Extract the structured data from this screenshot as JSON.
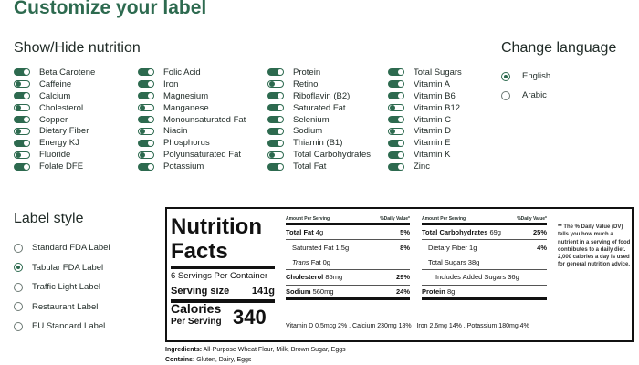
{
  "page_title": "Customize your label",
  "show_hide": {
    "title": "Show/Hide nutrition",
    "columns": [
      [
        {
          "label": "Beta Carotene",
          "on": true
        },
        {
          "label": "Caffeine",
          "on": false
        },
        {
          "label": "Calcium",
          "on": true
        },
        {
          "label": "Cholesterol",
          "on": false
        },
        {
          "label": "Copper",
          "on": true
        },
        {
          "label": "Dietary Fiber",
          "on": false
        },
        {
          "label": "Energy KJ",
          "on": true
        },
        {
          "label": "Fluoride",
          "on": false
        },
        {
          "label": "Folate DFE",
          "on": true
        }
      ],
      [
        {
          "label": "Folic Acid",
          "on": true
        },
        {
          "label": "Iron",
          "on": true
        },
        {
          "label": "Magnesium",
          "on": true
        },
        {
          "label": "Manganese",
          "on": false
        },
        {
          "label": "Monounsaturated Fat",
          "on": true
        },
        {
          "label": "Niacin",
          "on": false
        },
        {
          "label": "Phosphorus",
          "on": true
        },
        {
          "label": "Polyunsaturated Fat",
          "on": false
        },
        {
          "label": "Potassium",
          "on": true
        }
      ],
      [
        {
          "label": "Protein",
          "on": true
        },
        {
          "label": "Retinol",
          "on": false
        },
        {
          "label": "Riboflavin (B2)",
          "on": true
        },
        {
          "label": "Saturated Fat",
          "on": true
        },
        {
          "label": "Selenium",
          "on": true
        },
        {
          "label": "Sodium",
          "on": true
        },
        {
          "label": "Thiamin (B1)",
          "on": true
        },
        {
          "label": "Total Carbohydrates",
          "on": false
        },
        {
          "label": "Total Fat",
          "on": true
        }
      ],
      [
        {
          "label": "Total Sugars",
          "on": true
        },
        {
          "label": "Vitamin A",
          "on": true
        },
        {
          "label": "Vitamin B6",
          "on": true
        },
        {
          "label": "Vitamin B12",
          "on": false
        },
        {
          "label": "Vitamin C",
          "on": true
        },
        {
          "label": "Vitamin D",
          "on": false
        },
        {
          "label": "Vitamin E",
          "on": true
        },
        {
          "label": "Vitamin K",
          "on": true
        },
        {
          "label": "Zinc",
          "on": true
        }
      ]
    ]
  },
  "language": {
    "title": "Change language",
    "options": [
      {
        "label": "English",
        "checked": true
      },
      {
        "label": "Arabic",
        "checked": false
      }
    ]
  },
  "label_style": {
    "title": "Label style",
    "options": [
      {
        "label": "Standard FDA Label",
        "checked": false
      },
      {
        "label": "Tabular FDA Label",
        "checked": true
      },
      {
        "label": "Traffic Light Label",
        "checked": false
      },
      {
        "label": "Restaurant Label",
        "checked": false
      },
      {
        "label": "EU Standard Label",
        "checked": false
      }
    ]
  },
  "nutrition_label": {
    "title_line1": "Nutrition",
    "title_line2": "Facts",
    "servings": "6 Servings Per Container",
    "serving_size_label": "Serving size",
    "serving_size_value": "141g",
    "calories_label": "Calories",
    "per_serving_label": "Per Serving",
    "calories_value": "340",
    "amount_per_serving": "Amount Per Serving",
    "daily_value_header": "%Daily Value*",
    "left_rows": [
      {
        "name": "Total Fat",
        "amount": "4g",
        "dv": "5%",
        "bold": true,
        "indent": 0
      },
      {
        "name": "Saturated Fat",
        "amount": "1.5g",
        "dv": "8%",
        "bold": false,
        "indent": 1
      },
      {
        "name": "Trans",
        "amount": "Fat 0g",
        "dv": "",
        "bold": false,
        "indent": 1,
        "italic": true
      },
      {
        "name": "Cholesterol",
        "amount": "85mg",
        "dv": "29%",
        "bold": true,
        "indent": 0
      },
      {
        "name": "Sodium",
        "amount": "560mg",
        "dv": "24%",
        "bold": true,
        "indent": 0
      }
    ],
    "right_rows": [
      {
        "name": "Total Carbohydrates",
        "amount": "69g",
        "dv": "25%",
        "bold": true,
        "indent": 0
      },
      {
        "name": "Dietary Fiber",
        "amount": "1g",
        "dv": "4%",
        "bold": false,
        "indent": 1
      },
      {
        "name": "Total Sugars",
        "amount": "38g",
        "dv": "",
        "bold": false,
        "indent": 1
      },
      {
        "name": "Includes Added Sugars",
        "amount": "36g",
        "dv": "",
        "bold": false,
        "indent": 2
      },
      {
        "name": "Protein",
        "amount": "8g",
        "dv": "",
        "bold": true,
        "indent": 0
      }
    ],
    "footnote": "** The % Daily Value (DV) tells you how much a nutrient in a serving of food contributes to a daily diet. 2,000 calories a day is used for general nutrition advice.",
    "minerals": "Vitamin D 0.5mcg 2% . Calcium 230mg 18% . Iron 2.6mg 14% . Potassium 180mg 4%"
  },
  "ingredients": {
    "label": "Ingredients:",
    "text": "All-Purpose Wheat Flour, Milk, Brown Sugar, Eggs"
  },
  "contains": {
    "label": "Contains:",
    "text": "Gluten, Dairy, Eggs"
  },
  "colors": {
    "accent": "#2d6a4f",
    "text": "#1f2a26"
  }
}
